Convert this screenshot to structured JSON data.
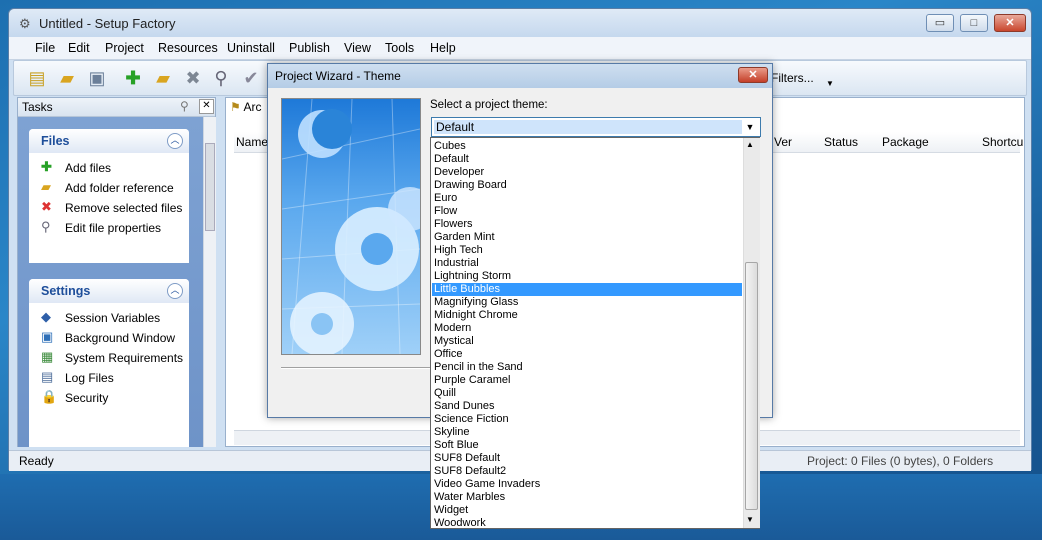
{
  "window": {
    "title": "Untitled - Setup Factory",
    "controls": {
      "minimize": "▭",
      "maximize": "□",
      "close": "✕"
    }
  },
  "menu": [
    "File",
    "Edit",
    "Project",
    "Resources",
    "Uninstall",
    "Publish",
    "View",
    "Tools",
    "Help"
  ],
  "toolbar": {
    "filters_label": "Filters..."
  },
  "tasks": {
    "title": "Tasks",
    "groups": [
      {
        "title": "Files",
        "items": [
          "Add files",
          "Add folder reference",
          "Remove selected files",
          "Edit file properties"
        ]
      },
      {
        "title": "Settings",
        "items": [
          "Session Variables",
          "Background Window",
          "System Requirements",
          "Log Files",
          "Security"
        ]
      }
    ]
  },
  "files": {
    "tab_label": "Arc",
    "columns": [
      "Name",
      "Ver",
      "Status",
      "Package",
      "Shortcu"
    ]
  },
  "status": {
    "left": "Ready",
    "right": "Project: 0 Files (0 bytes), 0 Folders"
  },
  "dialog": {
    "title": "Project Wizard - Theme",
    "prompt": "Select a project theme:",
    "selected_value": "Default",
    "themes": [
      "Cubes",
      "Default",
      "Developer",
      "Drawing Board",
      "Euro",
      "Flow",
      "Flowers",
      "Garden Mint",
      "High Tech",
      "Industrial",
      "Lightning Storm",
      "Little Bubbles",
      "Magnifying Glass",
      "Midnight Chrome",
      "Modern",
      "Mystical",
      "Office",
      "Pencil in the Sand",
      "Purple Caramel",
      "Quill",
      "Sand Dunes",
      "Science Fiction",
      "Skyline",
      "Soft Blue",
      "SUF8 Default",
      "SUF8 Default2",
      "Video Game Invaders",
      "Water Marbles",
      "Widget",
      "Woodwork"
    ],
    "highlighted_theme": "Little Bubbles"
  },
  "colors": {
    "accent": "#3399ff",
    "group_title": "#1e4e9a",
    "tasks_bg": "#7ea2d3"
  }
}
